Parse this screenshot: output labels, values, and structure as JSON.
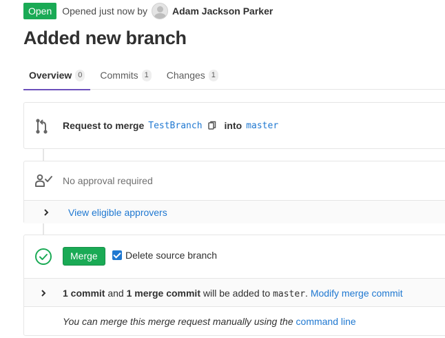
{
  "header": {
    "status": "Open",
    "opened_text": "Opened just now by",
    "author": "Adam Jackson Parker"
  },
  "title": "Added new branch",
  "tabs": [
    {
      "label": "Overview",
      "count": "0",
      "active": true
    },
    {
      "label": "Commits",
      "count": "1",
      "active": false
    },
    {
      "label": "Changes",
      "count": "1",
      "active": false
    }
  ],
  "merge_info": {
    "prefix": "Request to merge",
    "source_branch": "TestBranch",
    "into": "into",
    "target_branch": "master"
  },
  "approval": {
    "status": "No approval required",
    "view_approvers": "View eligible approvers"
  },
  "merge_widget": {
    "button": "Merge",
    "delete_source_label": "Delete source branch",
    "delete_source_checked": true,
    "commit_count": "1 commit",
    "and": "and",
    "merge_commit": "1 merge commit",
    "will_be_added": "will be added to",
    "target_branch": "master",
    "period": ".",
    "modify_link": "Modify merge commit",
    "manual_text": "You can merge this merge request manually using the",
    "command_line_link": "command line"
  },
  "colors": {
    "success": "#1aaa55",
    "link": "#1f78d1",
    "active_tab": "#6b4fbb"
  }
}
